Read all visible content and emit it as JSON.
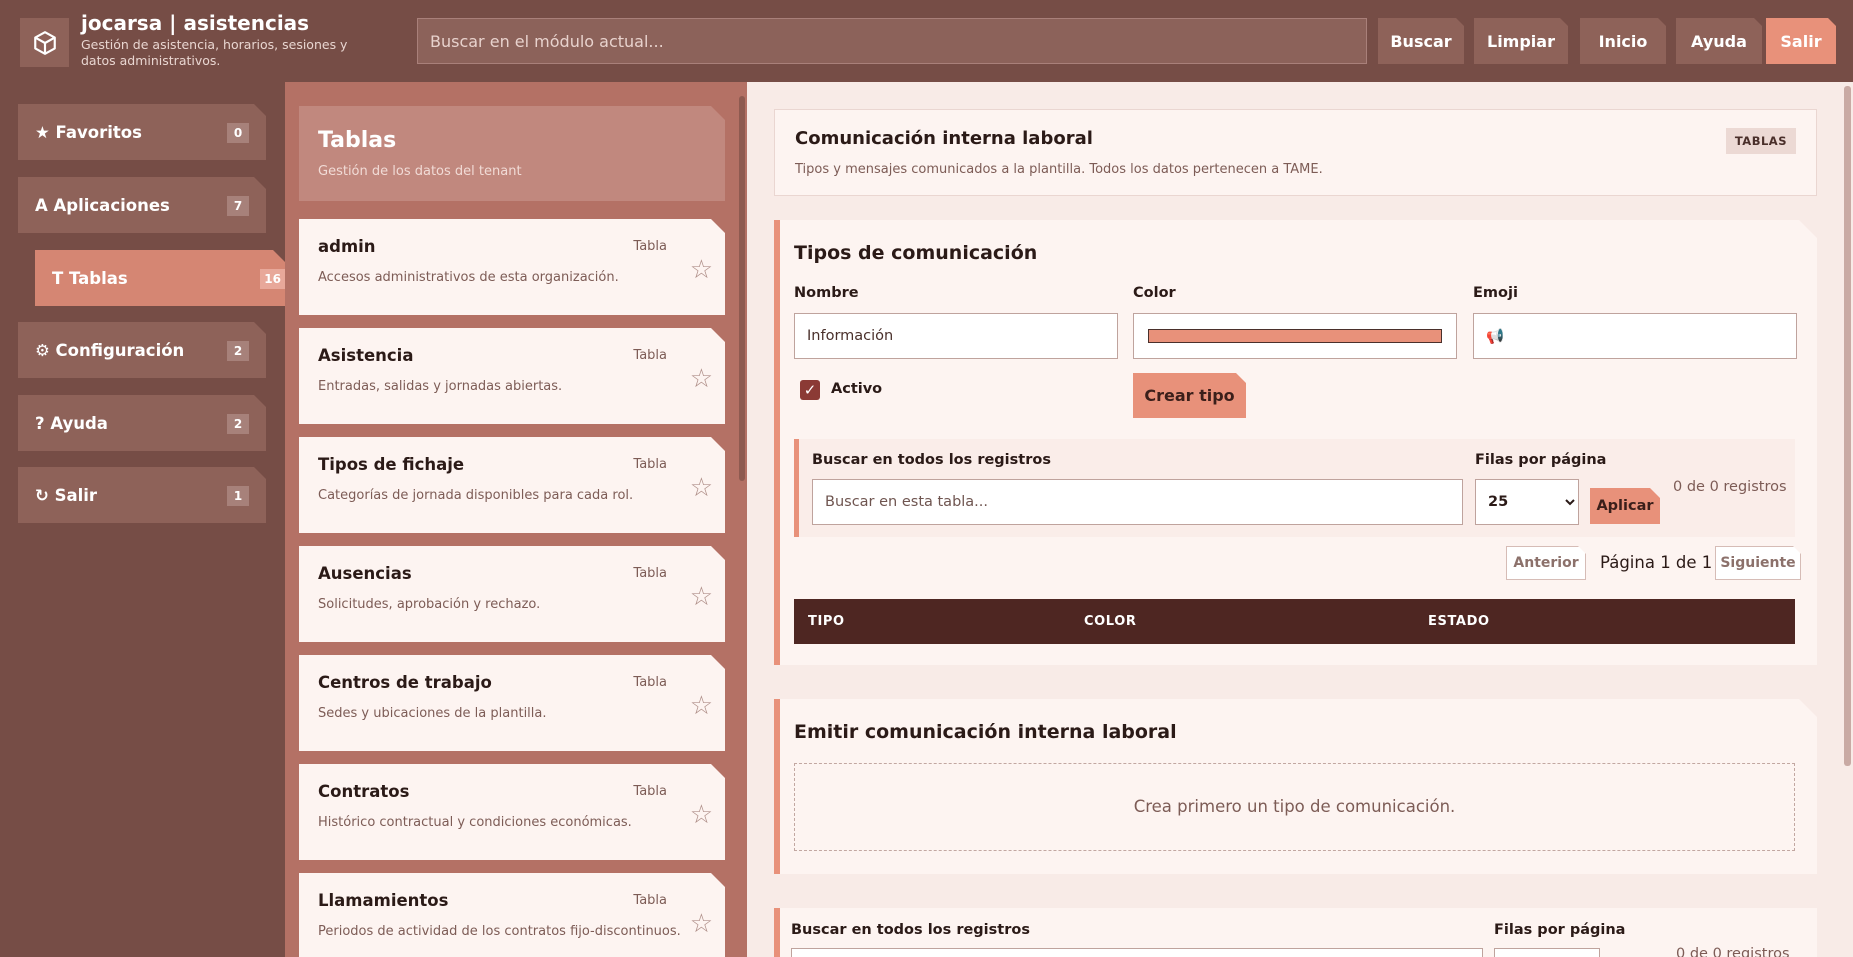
{
  "app": {
    "title": "jocarsa | asistencias",
    "subtitle": "Gestión de asistencia, horarios, sesiones y datos administrativos.",
    "logo_icon": "cube-icon",
    "search_placeholder": "Buscar en el módulo actual...",
    "buttons": [
      "Buscar",
      "Limpiar",
      "Inicio",
      "Ayuda",
      "Salir"
    ]
  },
  "nav": {
    "items": [
      {
        "label": "★ Favoritos",
        "count": "0"
      },
      {
        "label": "A Aplicaciones",
        "count": "7"
      },
      {
        "label": "T Tablas",
        "count": "16"
      },
      {
        "label": "⚙ Configuración",
        "count": "2"
      },
      {
        "label": "? Ayuda",
        "count": "2"
      },
      {
        "label": "↻ Salir",
        "count": "1"
      }
    ]
  },
  "tables_panel": {
    "title": "Tablas",
    "subtitle": "Gestión de los datos del tenant",
    "kind_label": "Tabla",
    "cards": [
      {
        "title": "admin",
        "desc": "Accesos administrativos de esta organización."
      },
      {
        "title": "Asistencia",
        "desc": "Entradas, salidas y jornadas abiertas."
      },
      {
        "title": "Tipos de fichaje",
        "desc": "Categorías de jornada disponibles para cada rol."
      },
      {
        "title": "Ausencias",
        "desc": "Solicitudes, aprobación y rechazo."
      },
      {
        "title": "Centros de trabajo",
        "desc": "Sedes y ubicaciones de la plantilla."
      },
      {
        "title": "Contratos",
        "desc": "Histórico contractual y condiciones económicas."
      },
      {
        "title": "Llamamientos",
        "desc": "Periodos de actividad de los contratos fijo-discontinuos."
      }
    ]
  },
  "content": {
    "header": {
      "title": "Comunicación interna laboral",
      "subtitle": "Tipos y mensajes comunicados a la plantilla. Todos los datos pertenecen a TAME.",
      "tag": "TABLAS"
    },
    "types_section": {
      "title": "Tipos de comunicación",
      "name_label": "Nombre",
      "name_value": "Información",
      "color_label": "Color",
      "color_value": "#e8917a",
      "emoji_label": "Emoji",
      "emoji_value": "📢",
      "active_label": "Activo",
      "create_button": "Crear tipo",
      "search_label": "Buscar en todos los registros",
      "search_placeholder": "Buscar en esta tabla...",
      "rows_label": "Filas por página",
      "rows_value": "25",
      "apply_button": "Aplicar",
      "records": "0 de 0 registros",
      "prev": "Anterior",
      "page_info": "Página 1 de 1",
      "next": "Siguiente",
      "columns": [
        "TIPO",
        "COLOR",
        "ESTADO"
      ]
    },
    "emit_section": {
      "title": "Emitir comunicación interna laboral",
      "empty": "Crea primero un tipo de comunicación."
    },
    "bottom_search": {
      "search_label": "Buscar en todos los registros",
      "rows_label": "Filas por página",
      "records": "0 de 0 registros"
    }
  }
}
